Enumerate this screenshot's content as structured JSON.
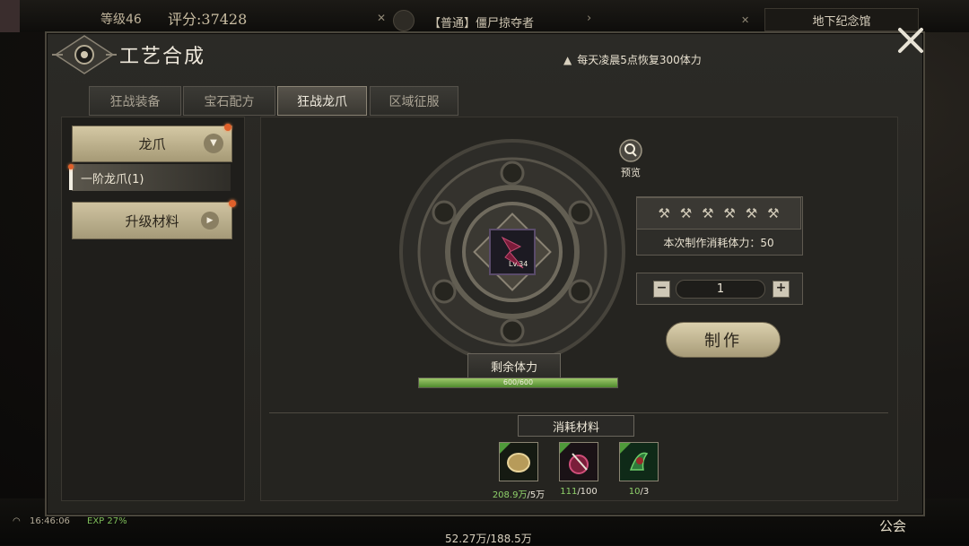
{
  "hud": {
    "level": "等级46",
    "score": "评分:37428",
    "chat_channel": "【普通】僵尸掠夺者",
    "location": "地下纪念馆",
    "time": "16:46:06",
    "exp": "EXP 27%",
    "gold": "52.27万/188.5万",
    "guild": "公会"
  },
  "panel": {
    "title": "工艺合成",
    "notice": "每天凌晨5点恢复300体力",
    "tabs": [
      {
        "label": "狂战装备"
      },
      {
        "label": "宝石配方"
      },
      {
        "label": "狂战龙爪",
        "active": true
      },
      {
        "label": "区域征服"
      }
    ]
  },
  "sidebar": {
    "category": "龙爪",
    "sub_item": "一阶龙爪(1)",
    "upgrade": "升级材料"
  },
  "craft": {
    "item_level": "Lv.34",
    "preview_label": "预览",
    "cost_text": "本次制作消耗体力：50",
    "quantity": "1",
    "make_label": "制作",
    "stamina_label": "剩余体力",
    "stamina_text": "600/600",
    "stamina_fraction": 1.0
  },
  "materials": {
    "header": "消耗材料",
    "items": [
      {
        "name": "coin-icon",
        "have": "208.9万",
        "need": "/5万"
      },
      {
        "name": "potion-icon",
        "have": "111",
        "need": "/100"
      },
      {
        "name": "herb-icon",
        "have": "10",
        "need": "/3"
      }
    ]
  },
  "colors": {
    "accent_green": "#8fd16a",
    "panel_bg": "#2b2a26",
    "button_gold": "#cfc3a0",
    "red_dot": "#e0602a"
  }
}
